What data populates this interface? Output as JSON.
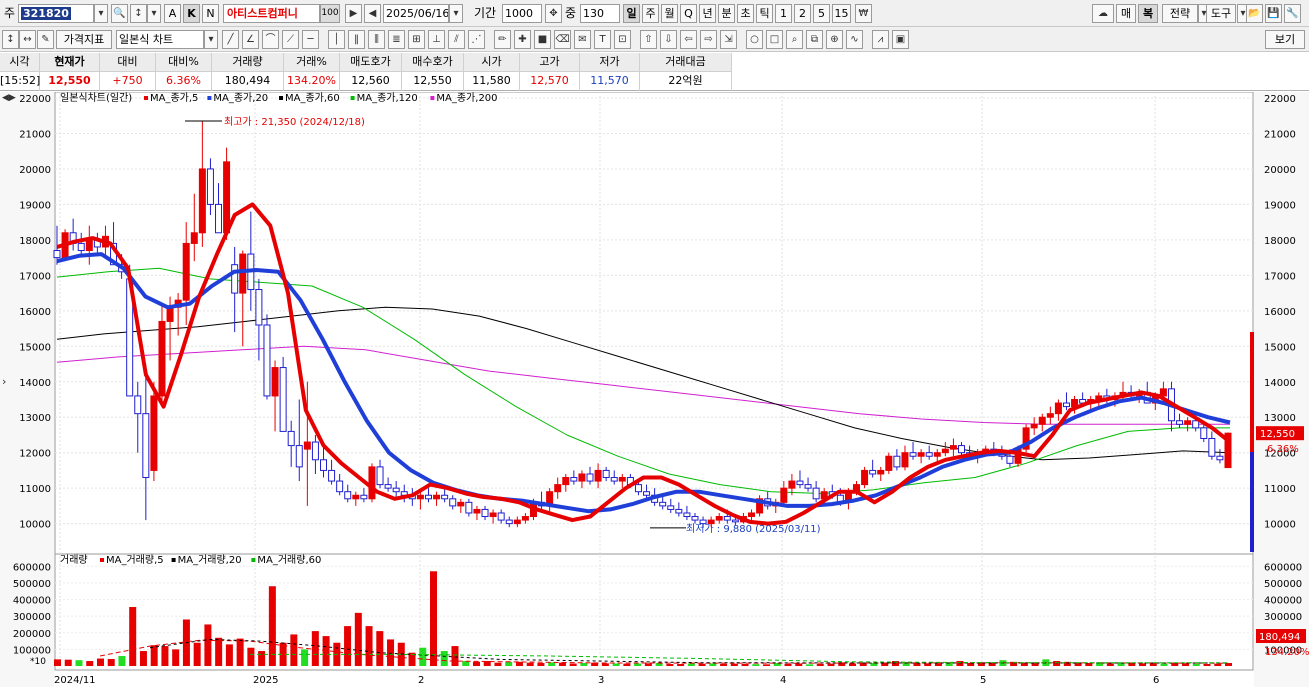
{
  "toolbar": {
    "market_label": "주",
    "stock_code": "321820",
    "btn_a": "A",
    "btn_k": "K",
    "btn_n": "N",
    "stock_name": "아티스트컴퍼니",
    "badge_100": "100",
    "date": "2025/06/16",
    "period_label": "기간",
    "period_value": "1000",
    "zoom_label": "중",
    "zoom_value": "130",
    "periods": [
      "일",
      "주",
      "월",
      "Q",
      "년",
      "분",
      "초",
      "틱",
      "1",
      "2",
      "5",
      "15"
    ],
    "right_buttons": [
      "매",
      "복",
      "전략",
      "도구"
    ],
    "indicator_select": "가격지표",
    "chart_type_select": "일본식 차트",
    "view_button": "보기"
  },
  "quote": {
    "headers": [
      "시각",
      "현재가",
      "대비",
      "대비%",
      "거래량",
      "거래%",
      "매도호가",
      "매수호가",
      "시가",
      "고가",
      "저가",
      "거래대금"
    ],
    "values": [
      "[15:52]",
      "12,550",
      "+750",
      "6.36%",
      "180,494",
      "134.20%",
      "12,560",
      "12,550",
      "11,580",
      "12,570",
      "11,570",
      "22억원"
    ]
  },
  "chart_data": [
    {
      "type": "candlestick",
      "legend": "일본식차트(일간)",
      "ma_legend": [
        "MA_종가,5",
        "MA_종가,20",
        "MA_종가,60",
        "MA_종가,120",
        "MA_종가,200"
      ],
      "ma_colors": [
        "#e60000",
        "#1f3fd8",
        "#000000",
        "#00bb00",
        "#d020d0"
      ],
      "y_ticks": [
        10000,
        11000,
        12000,
        13000,
        14000,
        15000,
        16000,
        17000,
        18000,
        19000,
        20000,
        21000,
        22000
      ],
      "ylim": [
        9200,
        22000
      ],
      "x_ticks": [
        "2024/11",
        "2025",
        "2",
        "3",
        "4",
        "5",
        "6"
      ],
      "high_annotation": "최고가 : 21,350 (2024/12/18)",
      "low_annotation": "최저가 : 9,880 (2025/03/11)",
      "last_price_label": "12,550",
      "last_pct_label": "6.36%",
      "ma5": [
        17800,
        17950,
        18050,
        17900,
        17200,
        14200,
        13300,
        14800,
        16400,
        17600,
        18700,
        19000,
        18400,
        16500,
        13200,
        12200,
        11700,
        11300,
        10900,
        10700,
        10800,
        11100,
        11000,
        10850,
        10750,
        10700,
        10600,
        10400,
        10250,
        10100,
        10200,
        10600,
        11000,
        11300,
        11300,
        11100,
        10800,
        10500,
        10250,
        10050,
        10000,
        10050,
        10300,
        10600,
        10900,
        10900,
        10600,
        10900,
        11300,
        11600,
        11800,
        11900,
        12000,
        12050,
        12000,
        11900,
        12500,
        13200,
        13400,
        13500,
        13600,
        13700,
        13600,
        13300,
        13000,
        12700,
        12300
      ],
      "ma20": [
        17400,
        17550,
        17600,
        17200,
        16400,
        16100,
        16200,
        16700,
        17100,
        17150,
        17100,
        16300,
        15200,
        14000,
        12900,
        12000,
        11500,
        11150,
        10950,
        10800,
        10700,
        10650,
        10550,
        10450,
        10350,
        10400,
        10550,
        10750,
        10900,
        10900,
        10800,
        10700,
        10600,
        10500,
        10500,
        10550,
        10650,
        10800,
        11050,
        11300,
        11600,
        11800,
        11950,
        12000,
        12300,
        12700,
        13000,
        13250,
        13450,
        13550,
        13400,
        13200,
        13000,
        12850
      ],
      "ma60": [
        15200,
        15350,
        15450,
        15550,
        15700,
        15850,
        16000,
        16100,
        16050,
        15850,
        15500,
        15100,
        14700,
        14300,
        13900,
        13500,
        13100,
        12700,
        12400,
        12150,
        11950,
        11800,
        11850,
        11950,
        12050,
        12000
      ],
      "ma120": [
        16950,
        17100,
        17200,
        16900,
        16800,
        16700,
        16100,
        15200,
        14200,
        13300,
        12500,
        11900,
        11400,
        11100,
        10900,
        10850,
        10950,
        11150,
        11300,
        11700,
        12200,
        12600,
        12700,
        12700
      ],
      "ma200": [
        14550,
        14700,
        14800,
        14900,
        15000,
        14900,
        14600,
        14300,
        14100,
        13900,
        13700,
        13500,
        13300,
        13100,
        12950,
        12850,
        12800,
        12800,
        12800,
        12800
      ]
    },
    {
      "type": "bar",
      "legend": "거래량",
      "ma_legend": [
        "MA_거래량,5",
        "MA_거래량,20",
        "MA_거래량,60"
      ],
      "ma_colors": [
        "#e60000",
        "#000000",
        "#00bb00"
      ],
      "y_ticks": [
        100000,
        200000,
        300000,
        400000,
        500000,
        600000
      ],
      "ylim": [
        0,
        650000
      ],
      "multiplier_label": "*10",
      "last_volume_label": "180,494",
      "last_volume_pct_label": "134.20%",
      "values": [
        40000,
        38000,
        35000,
        30000,
        45000,
        42000,
        60000,
        355000,
        90000,
        125000,
        120000,
        100000,
        280000,
        140000,
        250000,
        170000,
        130000,
        165000,
        110000,
        90000,
        480000,
        140000,
        190000,
        100000,
        210000,
        180000,
        140000,
        240000,
        320000,
        240000,
        210000,
        160000,
        140000,
        80000,
        110000,
        570000,
        90000,
        120000,
        30000,
        25000,
        30000,
        20000,
        25000,
        25000,
        20000,
        18000,
        22000,
        20000,
        15000,
        18000,
        20000,
        16000,
        15000,
        14000,
        15000,
        16000,
        18000,
        12000,
        12000,
        15000,
        14000,
        16000,
        13000,
        14000,
        12000,
        11000,
        10000,
        18000,
        12000,
        15000,
        10000,
        12000,
        14000,
        22000,
        15000,
        16000,
        18000,
        20000,
        30000,
        22000,
        18000,
        16000,
        15000,
        20000,
        30000,
        18000,
        22000,
        20000,
        35000,
        25000,
        20000,
        18000,
        40000,
        30000,
        25000,
        20000,
        18000,
        22000,
        15000,
        18000,
        20000,
        16000,
        15000,
        14000,
        15000,
        16000,
        13000,
        12000,
        14000,
        18000
      ],
      "up": [
        1,
        1,
        0,
        1,
        1,
        1,
        0,
        1,
        1,
        1,
        1,
        1,
        1,
        1,
        1,
        1,
        1,
        1,
        1,
        1,
        1,
        1,
        1,
        0,
        1,
        1,
        1,
        1,
        1,
        1,
        1,
        1,
        1,
        1,
        0,
        1,
        0,
        1,
        0,
        1,
        1,
        1,
        0,
        1,
        1,
        1,
        0,
        1,
        1,
        0,
        1,
        1,
        0,
        1,
        0,
        1,
        0,
        1,
        1,
        0,
        1,
        0,
        1,
        1,
        1,
        0,
        1,
        0,
        1,
        1,
        0,
        1,
        1,
        1,
        1,
        1,
        0,
        1,
        1,
        0,
        1,
        1,
        1,
        0,
        1,
        1,
        1,
        1,
        0,
        1,
        1,
        1,
        0,
        1,
        1,
        1,
        1,
        0,
        1,
        0,
        1,
        1,
        1,
        0,
        1,
        1,
        0,
        1,
        1,
        1
      ]
    }
  ],
  "candles": [
    [
      17700,
      18400,
      17300,
      17500
    ],
    [
      17500,
      18300,
      17400,
      18200
    ],
    [
      18200,
      18600,
      17700,
      17900
    ],
    [
      17900,
      18200,
      17600,
      17700
    ],
    [
      17700,
      18400,
      17300,
      18000
    ],
    [
      18000,
      18200,
      17600,
      17800
    ],
    [
      17800,
      18400,
      17500,
      18100
    ],
    [
      17900,
      18500,
      17600,
      17300
    ],
    [
      17300,
      17600,
      16900,
      17100
    ],
    [
      16900,
      17300,
      15500,
      13600
    ],
    [
      13600,
      14000,
      12000,
      13100
    ],
    [
      13100,
      14200,
      10100,
      11300
    ],
    [
      11500,
      14000,
      11200,
      13600
    ],
    [
      13600,
      16200,
      13300,
      15700
    ],
    [
      15700,
      16400,
      14600,
      16100
    ],
    [
      16100,
      16500,
      15300,
      16300
    ],
    [
      16300,
      18500,
      15600,
      17900
    ],
    [
      17900,
      19300,
      17400,
      18200
    ],
    [
      18200,
      21350,
      17800,
      20000
    ],
    [
      20000,
      20300,
      18700,
      19000
    ],
    [
      19000,
      19600,
      18400,
      18200
    ],
    [
      18200,
      20600,
      18000,
      20200
    ],
    [
      17300,
      17800,
      15400,
      16500
    ],
    [
      16500,
      17700,
      15000,
      17600
    ],
    [
      17600,
      18800,
      16000,
      16600
    ],
    [
      16600,
      16900,
      14600,
      15600
    ],
    [
      15600,
      15900,
      13500,
      13600
    ],
    [
      13600,
      14600,
      12600,
      14400
    ],
    [
      14400,
      14700,
      12700,
      12600
    ],
    [
      12600,
      12900,
      11600,
      12200
    ],
    [
      12200,
      13500,
      11200,
      11600
    ],
    [
      12100,
      14000,
      10500,
      12300
    ],
    [
      12300,
      12500,
      11400,
      11800
    ],
    [
      11800,
      12200,
      11300,
      11500
    ],
    [
      11500,
      11800,
      11100,
      11200
    ],
    [
      11200,
      11400,
      10800,
      10900
    ],
    [
      10900,
      11100,
      10600,
      10700
    ],
    [
      10700,
      10900,
      10500,
      10800
    ],
    [
      10800,
      11000,
      10600,
      10700
    ],
    [
      10700,
      11700,
      10600,
      11600
    ],
    [
      11600,
      11800,
      11000,
      11100
    ],
    [
      11100,
      11300,
      10900,
      11000
    ],
    [
      11000,
      11200,
      10700,
      10900
    ],
    [
      10900,
      11100,
      10600,
      10800
    ],
    [
      10800,
      11000,
      10500,
      10700
    ],
    [
      10700,
      10900,
      10400,
      10800
    ],
    [
      10800,
      11000,
      10600,
      10700
    ],
    [
      10700,
      10900,
      10500,
      10800
    ],
    [
      10800,
      11000,
      10600,
      10700
    ],
    [
      10700,
      10800,
      10400,
      10500
    ],
    [
      10500,
      10700,
      10300,
      10600
    ],
    [
      10600,
      10700,
      10200,
      10300
    ],
    [
      10300,
      10500,
      10100,
      10400
    ],
    [
      10400,
      10500,
      10100,
      10200
    ],
    [
      10200,
      10400,
      10000,
      10300
    ],
    [
      10300,
      10400,
      10000,
      10100
    ],
    [
      10100,
      10200,
      9900,
      10000
    ],
    [
      10000,
      10200,
      9900,
      10100
    ],
    [
      10100,
      10300,
      10000,
      10200
    ],
    [
      10200,
      10700,
      10100,
      10600
    ],
    [
      10600,
      10900,
      10400,
      10500
    ],
    [
      10500,
      11000,
      10300,
      10900
    ],
    [
      10900,
      11300,
      10700,
      11100
    ],
    [
      11100,
      11400,
      10900,
      11300
    ],
    [
      11300,
      11500,
      11100,
      11200
    ],
    [
      11200,
      11500,
      11000,
      11400
    ],
    [
      11400,
      11600,
      11100,
      11200
    ],
    [
      11200,
      11700,
      11000,
      11500
    ],
    [
      11500,
      11600,
      11200,
      11300
    ],
    [
      11300,
      11500,
      11100,
      11200
    ],
    [
      11200,
      11400,
      11000,
      11300
    ],
    [
      11300,
      11400,
      11000,
      11100
    ],
    [
      11100,
      11200,
      10800,
      10900
    ],
    [
      10900,
      11100,
      10700,
      10800
    ],
    [
      10800,
      11000,
      10500,
      10600
    ],
    [
      10600,
      10800,
      10400,
      10500
    ],
    [
      10500,
      10700,
      10300,
      10400
    ],
    [
      10400,
      10600,
      10200,
      10300
    ],
    [
      10300,
      10500,
      10100,
      10200
    ],
    [
      10200,
      10300,
      10000,
      10100
    ],
    [
      10100,
      10200,
      9880,
      10000
    ],
    [
      10000,
      10200,
      9900,
      10100
    ],
    [
      10100,
      10300,
      10000,
      10200
    ],
    [
      10200,
      10400,
      10000,
      10100
    ],
    [
      10100,
      10200,
      9950,
      10050
    ],
    [
      10050,
      10300,
      10000,
      10200
    ],
    [
      10200,
      10400,
      10100,
      10300
    ],
    [
      10300,
      10800,
      10200,
      10700
    ],
    [
      10700,
      10900,
      10400,
      10500
    ],
    [
      10500,
      10700,
      10300,
      10600
    ],
    [
      10600,
      11200,
      10500,
      11000
    ],
    [
      11000,
      11400,
      10800,
      11200
    ],
    [
      11200,
      11500,
      11000,
      11100
    ],
    [
      11100,
      11300,
      10900,
      11000
    ],
    [
      11000,
      11200,
      10600,
      10700
    ],
    [
      10700,
      11000,
      10500,
      10900
    ],
    [
      10900,
      11100,
      10700,
      10800
    ],
    [
      10800,
      11000,
      10500,
      10600
    ],
    [
      10600,
      11000,
      10400,
      10900
    ],
    [
      10900,
      11200,
      10800,
      11100
    ],
    [
      11100,
      11600,
      11000,
      11500
    ],
    [
      11500,
      11800,
      11300,
      11400
    ],
    [
      11400,
      11600,
      11200,
      11500
    ],
    [
      11500,
      12000,
      11400,
      11900
    ],
    [
      11900,
      12100,
      11500,
      11600
    ],
    [
      11600,
      12200,
      11500,
      12000
    ],
    [
      12000,
      12300,
      11800,
      11900
    ],
    [
      11900,
      12100,
      11700,
      12000
    ],
    [
      12000,
      12200,
      11800,
      11900
    ],
    [
      11900,
      12100,
      11700,
      12000
    ],
    [
      12000,
      12300,
      11900,
      12100
    ],
    [
      12100,
      12400,
      11900,
      12200
    ],
    [
      12200,
      12300,
      11900,
      12000
    ],
    [
      12000,
      12200,
      11800,
      11900
    ],
    [
      11900,
      12100,
      11700,
      12000
    ],
    [
      12000,
      12200,
      11900,
      12100
    ],
    [
      12100,
      12300,
      11900,
      12000
    ],
    [
      12000,
      12200,
      11800,
      11900
    ],
    [
      11900,
      12100,
      11600,
      11700
    ],
    [
      11700,
      12200,
      11600,
      12100
    ],
    [
      12100,
      12800,
      12000,
      12700
    ],
    [
      12700,
      13000,
      12500,
      12800
    ],
    [
      12800,
      13100,
      12600,
      13000
    ],
    [
      13000,
      13300,
      12800,
      13100
    ],
    [
      13100,
      13500,
      12900,
      13400
    ],
    [
      13400,
      13700,
      13200,
      13300
    ],
    [
      13300,
      13600,
      13100,
      13500
    ],
    [
      13500,
      13700,
      13300,
      13400
    ],
    [
      13400,
      13600,
      13200,
      13500
    ],
    [
      13500,
      13700,
      13300,
      13600
    ],
    [
      13600,
      13800,
      13400,
      13500
    ],
    [
      13500,
      13700,
      13300,
      13600
    ],
    [
      13600,
      14000,
      13500,
      13700
    ],
    [
      13700,
      13900,
      13500,
      13600
    ],
    [
      13600,
      13800,
      13400,
      13700
    ],
    [
      13700,
      14000,
      13500,
      13400
    ],
    [
      13400,
      13700,
      13200,
      13600
    ],
    [
      13600,
      14000,
      13500,
      13800
    ],
    [
      13800,
      14000,
      12600,
      12900
    ],
    [
      12900,
      13100,
      12700,
      12800
    ],
    [
      12800,
      13000,
      12600,
      12900
    ],
    [
      12900,
      13100,
      12600,
      12700
    ],
    [
      12700,
      12900,
      12300,
      12400
    ],
    [
      12400,
      12600,
      11800,
      11900
    ],
    [
      11900,
      12100,
      11700,
      11800
    ],
    [
      11580,
      12570,
      11570,
      12550
    ]
  ]
}
